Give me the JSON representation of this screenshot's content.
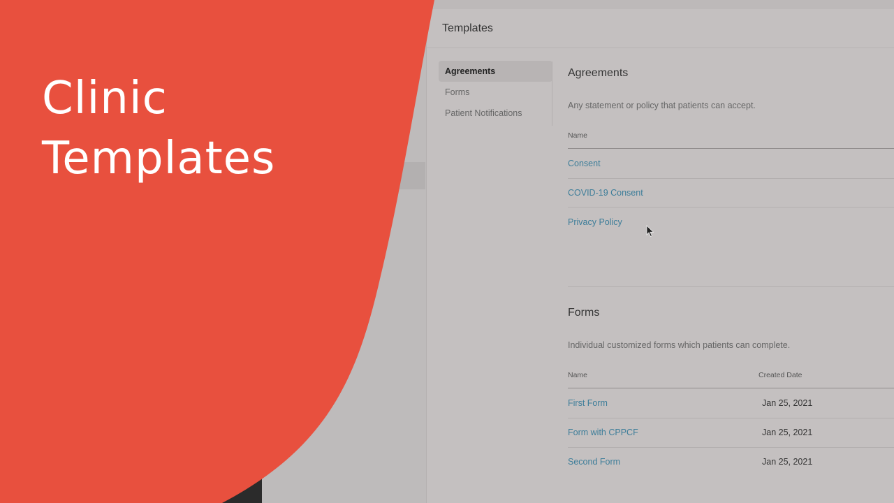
{
  "overlay": {
    "title_line1": "Clinic",
    "title_line2": "Templates",
    "color": "#e8503e"
  },
  "app": {
    "title": "Templates",
    "sidebar": {
      "items": [
        {
          "label": "Agreements",
          "active": true
        },
        {
          "label": "Forms",
          "active": false
        },
        {
          "label": "Patient Notifications",
          "active": false
        }
      ]
    },
    "agreements": {
      "title": "Agreements",
      "description": "Any statement or policy that patients can accept.",
      "columns": [
        "Name"
      ],
      "rows": [
        {
          "name": "Consent"
        },
        {
          "name": "COVID-19 Consent"
        },
        {
          "name": "Privacy Policy"
        }
      ]
    },
    "forms": {
      "title": "Forms",
      "description": "Individual customized forms which patients can complete.",
      "columns": [
        "Name",
        "Created Date"
      ],
      "rows": [
        {
          "name": "First Form",
          "created": "Jan 25, 2021"
        },
        {
          "name": "Form with CPPCF",
          "created": "Jan 25, 2021"
        },
        {
          "name": "Second Form",
          "created": "Jan 25, 2021"
        }
      ]
    }
  },
  "colors": {
    "link": "#3d7d99",
    "background": "#c4c0c0"
  }
}
